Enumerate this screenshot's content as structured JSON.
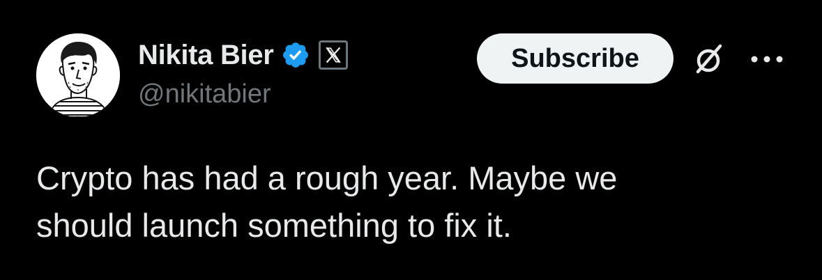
{
  "author": {
    "display_name": "Nikita Bier",
    "handle": "@nikitabier",
    "verified": true,
    "affiliate_badge": "x-logo-icon"
  },
  "actions": {
    "subscribe_label": "Subscribe",
    "grok_icon": "grok-icon",
    "more_icon": "more-options-icon"
  },
  "tweet": {
    "text": "Crypto has had a rough year. Maybe we\nshould launch something to fix it."
  },
  "colors": {
    "background": "#000000",
    "primary_text": "#e7e9ea",
    "secondary_text": "#71767b",
    "verified_blue": "#1d9bf0",
    "subscribe_bg": "#eff3f4"
  }
}
